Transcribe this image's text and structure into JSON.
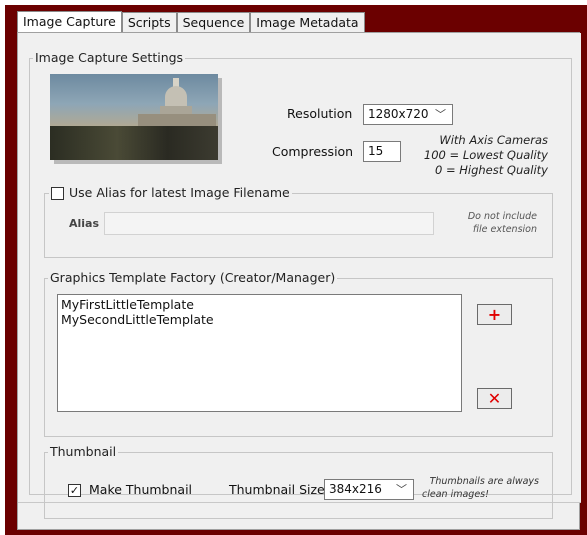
{
  "tabs": [
    {
      "label": "Image Capture",
      "active": true
    },
    {
      "label": "Scripts",
      "active": false
    },
    {
      "label": "Sequence",
      "active": false
    },
    {
      "label": "Image Metadata",
      "active": false
    }
  ],
  "capture": {
    "group_title": "Image Capture Settings",
    "resolution_label": "Resolution",
    "resolution_value": "1280x720",
    "compression_label": "Compression",
    "compression_value": "15",
    "axis_note": [
      "With Axis Cameras",
      "100 = Lowest Quality",
      "0 = Highest Quality"
    ]
  },
  "alias": {
    "checkbox_label": "Use Alias for latest Image Filename",
    "checked": false,
    "field_label": "Alias",
    "field_value": "",
    "note": [
      "Do not include",
      "file extension"
    ]
  },
  "templates": {
    "group_title": "Graphics Template Factory (Creator/Manager)",
    "items": [
      "MyFirstLittleTemplate",
      "MySecondLittleTemplate"
    ],
    "add_icon": "+",
    "delete_icon": "✕"
  },
  "thumbnail": {
    "group_title": "Thumbnail",
    "make_label": "Make Thumbnail",
    "make_checked": true,
    "size_label": "Thumbnail Size",
    "size_value": "384x216",
    "note": [
      "Thumbnails are always",
      "clean images!"
    ]
  },
  "icons": {
    "dropdown": "chevron-down-icon",
    "add": "plus-icon",
    "delete": "x-icon",
    "check": "✓"
  },
  "colors": {
    "frame": "#6b0000",
    "panel": "#f0f0f0",
    "danger": "#e00000"
  }
}
